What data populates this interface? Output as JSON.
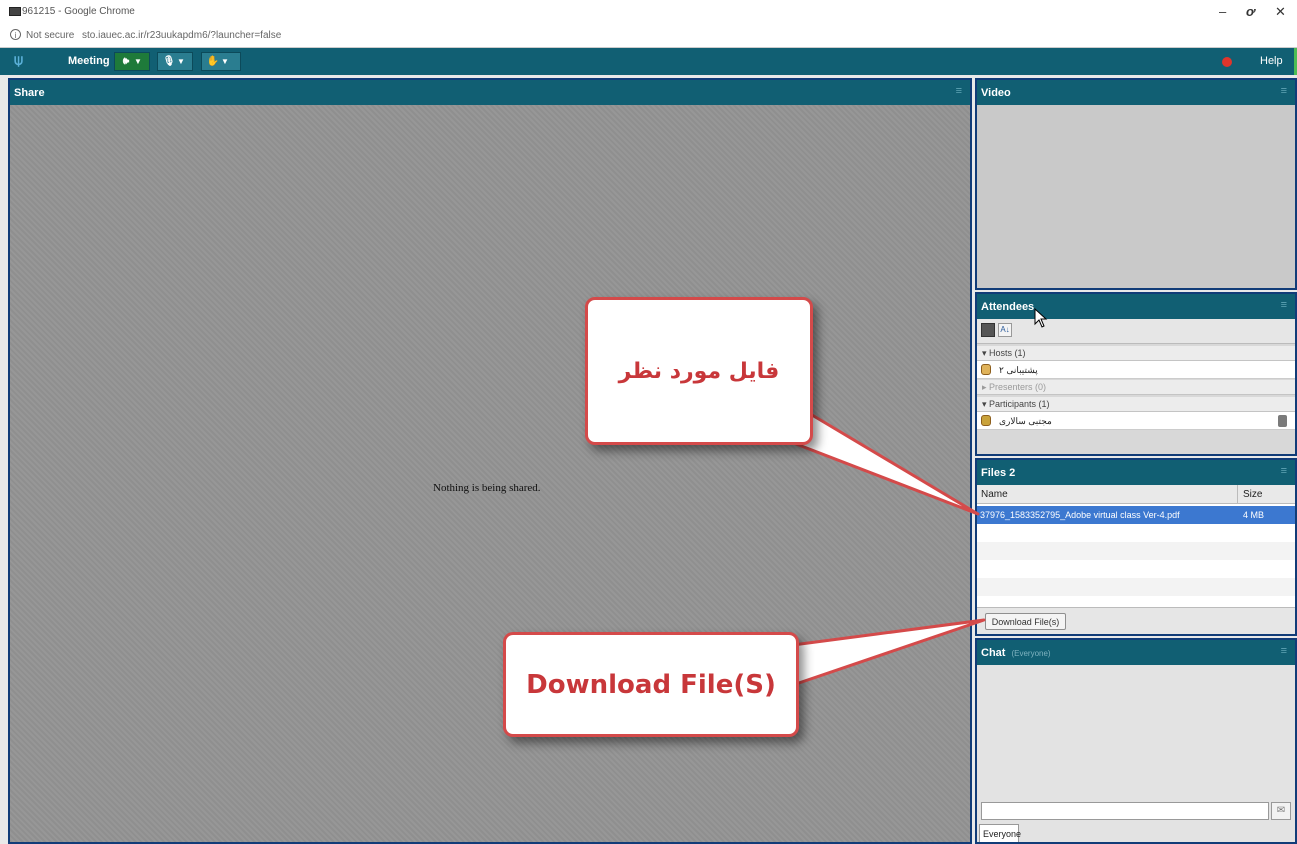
{
  "window": {
    "title": "961215 - Google Chrome",
    "controls": {
      "minimize": "–",
      "restore": "ơ",
      "close": "✕"
    }
  },
  "address_bar": {
    "security": "Not secure",
    "url": "sto.iauec.ac.ir/r23uukapdm6/?launcher=false"
  },
  "toolbar": {
    "meeting_label": "Meeting",
    "help_label": "Help",
    "icons": [
      "speaker-icon",
      "microphone-icon",
      "raise-hand-icon",
      "record-icon"
    ]
  },
  "share_pod": {
    "title": "Share",
    "message": "Nothing is being shared."
  },
  "video_pod": {
    "title": "Video"
  },
  "attendees_pod": {
    "title": "Attendees",
    "groups": {
      "hosts": "Hosts (1)",
      "presenters": "Presenters (0)",
      "participants": "Participants (1)"
    },
    "host_name": "پشتیبانی ۲",
    "participant_name": "مجتبی سالاری"
  },
  "files_pod": {
    "title": "Files 2",
    "columns": {
      "name": "Name",
      "size": "Size"
    },
    "files": [
      {
        "name": "37976_1583352795_Adobe virtual class Ver-4.pdf",
        "size": "4 MB"
      }
    ],
    "download_label": "Download File(s)"
  },
  "chat_pod": {
    "title": "Chat",
    "subtitle": "(Everyone)",
    "recipient": "Everyone"
  },
  "callouts": {
    "file_label": "فایل مورد نظر",
    "download_label": "Download File(S)"
  },
  "colors": {
    "toolbar_bg": "#115f73",
    "pod_border": "#113c78",
    "callout_border": "#d44a4a",
    "callout_text": "#c8373a",
    "selection": "#3c78d0",
    "record_dot": "#e0352c"
  }
}
